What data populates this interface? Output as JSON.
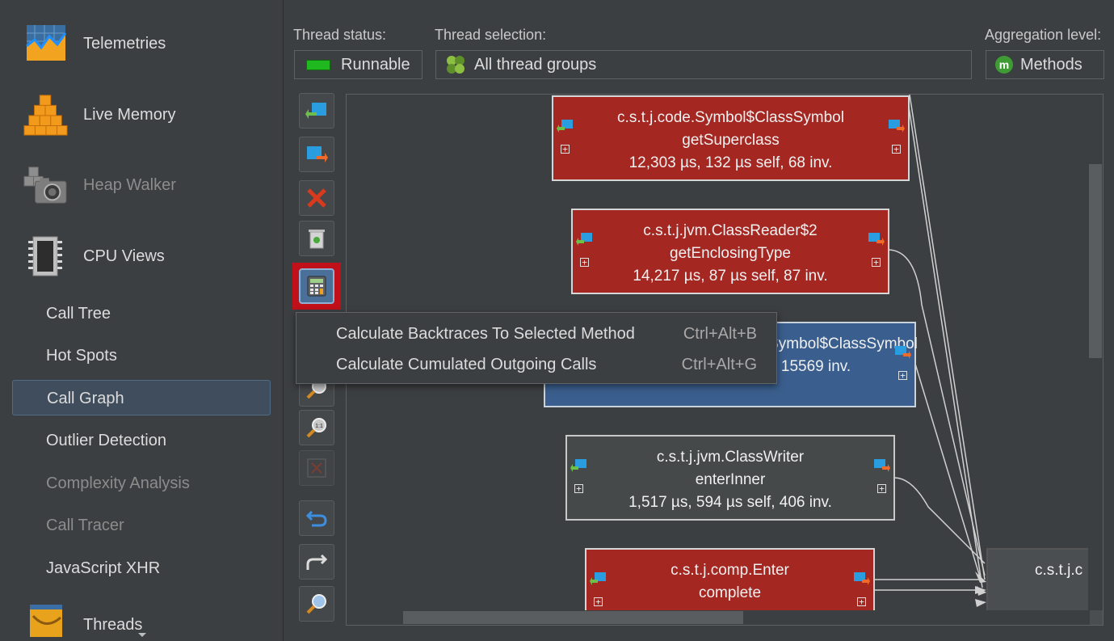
{
  "sidebar": {
    "sections": [
      {
        "label": "Telemetries",
        "icon": "telemetries-icon"
      },
      {
        "label": "Live Memory",
        "icon": "live-memory-icon"
      },
      {
        "label": "Heap Walker",
        "icon": "heap-walker-icon"
      },
      {
        "label": "CPU Views",
        "icon": "cpu-views-icon"
      },
      {
        "label": "Threads",
        "icon": "threads-icon"
      }
    ],
    "cpu_items": [
      {
        "label": "Call Tree"
      },
      {
        "label": "Hot Spots"
      },
      {
        "label": "Call Graph",
        "selected": true
      },
      {
        "label": "Outlier Detection"
      },
      {
        "label": "Complexity Analysis",
        "disabled": true
      },
      {
        "label": "Call Tracer",
        "disabled": true
      },
      {
        "label": "JavaScript XHR"
      }
    ]
  },
  "header": {
    "thread_status_label": "Thread status:",
    "thread_status_value": "Runnable",
    "thread_selection_label": "Thread selection:",
    "thread_selection_value": "All thread groups",
    "aggregation_label": "Aggregation level:",
    "aggregation_value": "Methods"
  },
  "toolbar": {
    "buttons": [
      {
        "name": "show-incoming-calls-button",
        "icon": "incoming-calls-icon"
      },
      {
        "name": "show-outgoing-calls-button",
        "icon": "outgoing-calls-icon"
      },
      {
        "name": "remove-node-button",
        "icon": "remove-icon"
      },
      {
        "name": "clear-graph-button",
        "icon": "trash-icon"
      },
      {
        "name": "calculate-button",
        "icon": "calculator-icon",
        "active": true
      },
      {
        "name": "zoom-fit-button",
        "icon": "zoom-fit-icon"
      },
      {
        "name": "zoom-100-button",
        "icon": "zoom-100-icon"
      },
      {
        "name": "layout-button",
        "icon": "layout-icon"
      },
      {
        "name": "undo-button",
        "icon": "undo-icon"
      },
      {
        "name": "redo-button",
        "icon": "redo-icon"
      },
      {
        "name": "find-button",
        "icon": "search-icon"
      }
    ]
  },
  "graph": {
    "nodes": [
      {
        "class_name": "c.s.t.j.code.Symbol$ClassSymbol",
        "method": "getSuperclass",
        "stats": "12,303 µs, 132 µs self, 68 inv.",
        "color": "#a52722"
      },
      {
        "class_name": "c.s.t.j.jvm.ClassReader$2",
        "method": "getEnclosingType",
        "stats": "14,217 µs, 87 µs self, 87 inv.",
        "color": "#a52722"
      },
      {
        "class_name": "c.s.t.j.code.Symbol$ClassSymbol",
        "method": "",
        "stats": "72,060 µs, 3,033 µs self, 15569 inv.",
        "color": "#3a5e8d"
      },
      {
        "class_name": "c.s.t.j.jvm.ClassWriter",
        "method": "enterInner",
        "stats": "1,517 µs, 594 µs self, 406 inv.",
        "color": "#45494a"
      },
      {
        "class_name": "c.s.t.j.comp.Enter",
        "method": "complete",
        "stats": "",
        "color": "#a52722"
      },
      {
        "class_name": "c.s.t.j.c",
        "method": "",
        "stats": "",
        "color": "#4b4e50"
      }
    ],
    "expand_symbol": "+"
  },
  "context_menu": {
    "items": [
      {
        "label": "Calculate Backtraces To Selected Method",
        "shortcut": "Ctrl+Alt+B"
      },
      {
        "label": "Calculate Cumulated Outgoing Calls",
        "shortcut": "Ctrl+Alt+G"
      }
    ]
  },
  "colors": {
    "background": "#3c3f41",
    "selection": "#3f4d5c",
    "hot_node": "#a52722",
    "selected_node": "#3a5e8d",
    "active_button_outline": "#c0101a",
    "runnable_green": "#1fb81f"
  }
}
